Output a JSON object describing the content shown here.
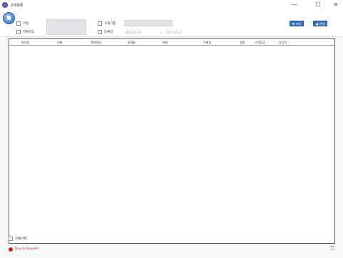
{
  "window": {
    "title": "고객목록",
    "minimize": "—",
    "maximize": "☐",
    "close": "✕"
  },
  "filters": {
    "name_label": "이름",
    "phone_label": "전화번호",
    "group_label": "고객그룹",
    "regdate_label": "등록일",
    "date_from": "2011-02-23",
    "date_sep": "~",
    "date_to": "2017-07-11"
  },
  "buttons": {
    "search": "▼ 조회",
    "excel": "▣ 엑셀"
  },
  "grid": {
    "columns": [
      "회사명",
      "이름",
      "전화번호",
      "휴대폰",
      "메일",
      "이메일",
      "생일",
      "고객등급",
      "담당자"
    ]
  },
  "footer": {
    "select_all_label": "전체선택",
    "bug_label": "Bug & Request",
    "version_line1": "ver",
    "version_line2": "1.0"
  }
}
